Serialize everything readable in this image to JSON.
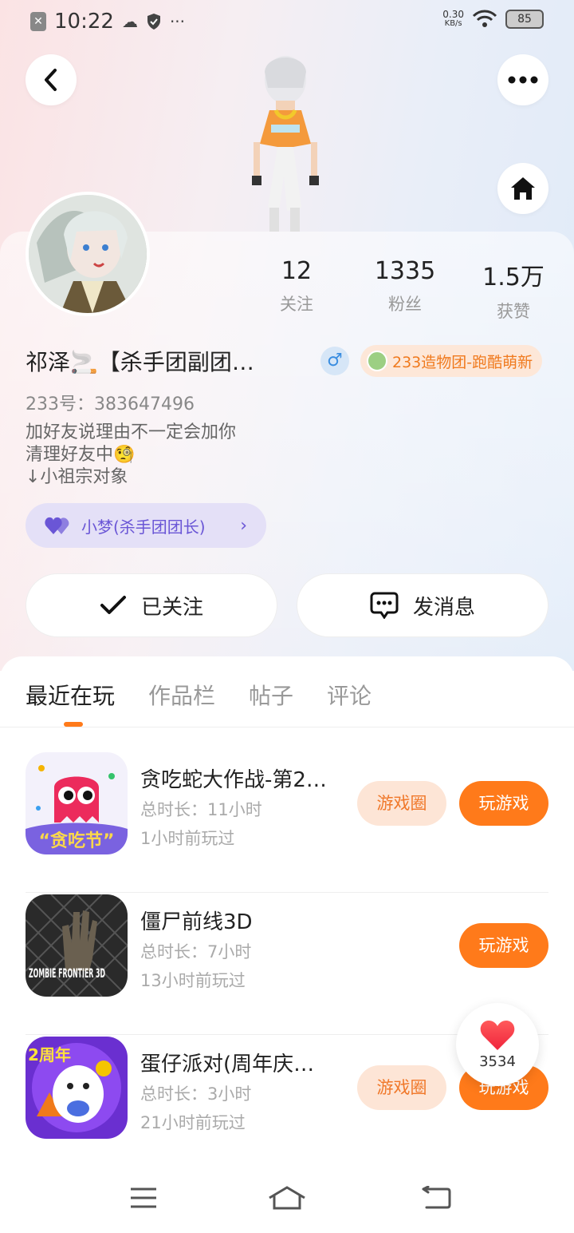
{
  "status_bar": {
    "time": "10:22",
    "net_speed": "0.30",
    "net_unit": "KB/s",
    "battery": "85"
  },
  "profile": {
    "nickname": "祁泽🚬【杀手团副团…",
    "gender_symbol": "♂",
    "group_tag": "233造物团-跑酷萌新",
    "uid": "233号：383647496",
    "bio_lines": [
      "加好友说理由不一定会加你",
      "清理好友中🧐",
      "↓小祖宗对象"
    ],
    "relation_label": "小梦(杀手团团长)",
    "relation_chevron": "›"
  },
  "stats": [
    {
      "value": "12",
      "label": "关注"
    },
    {
      "value": "1335",
      "label": "粉丝"
    },
    {
      "value": "1.5万",
      "label": "获赞"
    }
  ],
  "actions": {
    "follow_label": "已关注",
    "message_label": "发消息"
  },
  "tabs": [
    {
      "label": "最近在玩",
      "active": true
    },
    {
      "label": "作品栏",
      "active": false
    },
    {
      "label": "帖子",
      "active": false
    },
    {
      "label": "评论",
      "active": false
    }
  ],
  "games": [
    {
      "title": "贪吃蛇大作战-第2…",
      "duration": "总时长：11小时",
      "last_played": "1小时前玩过",
      "circle_label": "游戏圈",
      "play_label": "玩游戏",
      "icon_text": "“贪吃节”"
    },
    {
      "title": "僵尸前线3D",
      "duration": "总时长：7小时",
      "last_played": "13小时前玩过",
      "circle_label": "",
      "play_label": "玩游戏",
      "icon_text": "ZOMBIE FRONTIER 3D"
    },
    {
      "title": "蛋仔派对(周年庆…",
      "duration": "总时长：3小时",
      "last_played": "21小时前玩过",
      "circle_label": "游戏圈",
      "play_label": "玩游戏",
      "icon_text": "2周年"
    }
  ],
  "like_float": {
    "count": "3534"
  },
  "colors": {
    "accent": "#ff7a1a",
    "relation": "#6a56d6",
    "tag": "#f07a1e"
  }
}
